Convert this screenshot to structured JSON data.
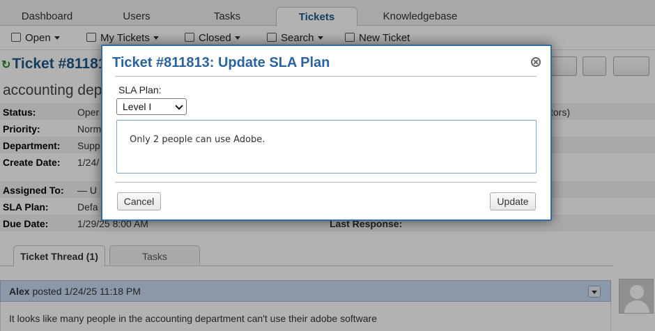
{
  "nav": {
    "tabs": [
      {
        "label": "Dashboard"
      },
      {
        "label": "Users"
      },
      {
        "label": "Tasks"
      },
      {
        "label": "Tickets"
      },
      {
        "label": "Knowledgebase"
      }
    ],
    "active_tab": "Tickets"
  },
  "subnav": {
    "items": [
      {
        "label": "Open",
        "icon": "folder-icon"
      },
      {
        "label": "My Tickets",
        "icon": "folder-icon"
      },
      {
        "label": "Closed",
        "icon": "folder-icon"
      },
      {
        "label": "Search",
        "icon": "search-icon"
      },
      {
        "label": "New Ticket",
        "icon": "new-ticket-icon"
      }
    ]
  },
  "ticket": {
    "title": "Ticket #81181",
    "subject": "accounting depa",
    "fields": [
      {
        "label": "Status:",
        "value": "Oper"
      },
      {
        "label": "Priority:",
        "value": "Norm"
      },
      {
        "label": "Department:",
        "value": "Supp"
      },
      {
        "label": "Create Date:",
        "value": "1/24/"
      }
    ],
    "fields2": [
      {
        "label": "Assigned To:",
        "value": "— U"
      },
      {
        "label": "SLA Plan:",
        "value": "Defa"
      },
      {
        "label": "Due Date:",
        "value": "1/29/25 8:00 AM"
      }
    ],
    "right_fragment": "tors)",
    "last_response_label": "Last Response:"
  },
  "thread": {
    "tabs": [
      {
        "label": "Ticket Thread (1)"
      },
      {
        "label": "Tasks"
      }
    ],
    "entry": {
      "author": "Alex",
      "posted": "posted 1/24/25 11:18 PM",
      "body": "It looks like many people in the accounting department can't use their adobe software"
    }
  },
  "modal": {
    "title": "Ticket #811813: Update SLA Plan",
    "sla_label": "SLA Plan:",
    "sla_selected": "Level I",
    "comment": "Only 2 people can use Adobe.",
    "cancel_label": "Cancel",
    "update_label": "Update"
  },
  "colors": {
    "accent": "#2a63a0",
    "entry_header": "#c9daf0"
  }
}
